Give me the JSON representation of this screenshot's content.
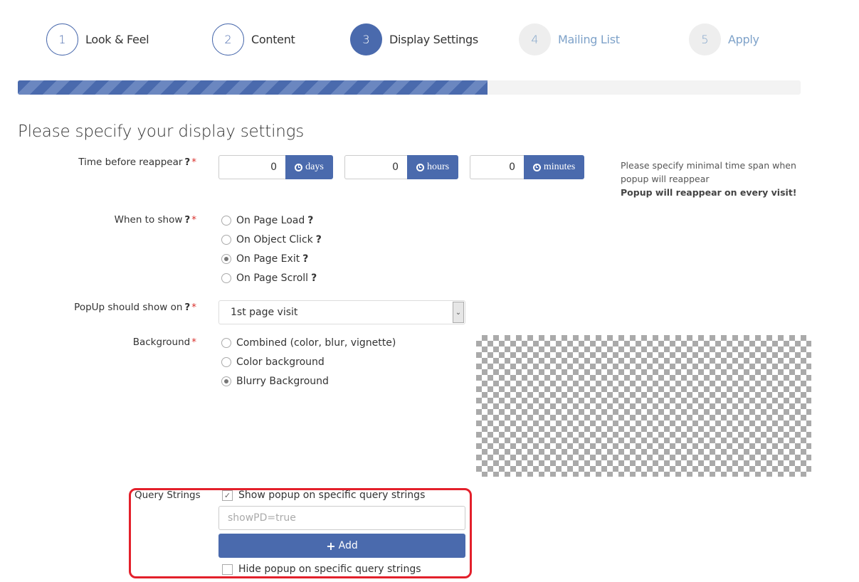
{
  "steps": [
    {
      "number": "1",
      "label": "Look & Feel",
      "state": "done"
    },
    {
      "number": "2",
      "label": "Content",
      "state": "done"
    },
    {
      "number": "3",
      "label": "Display Settings",
      "state": "active"
    },
    {
      "number": "4",
      "label": "Mailing List",
      "state": "todo"
    },
    {
      "number": "5",
      "label": "Apply",
      "state": "todo"
    }
  ],
  "progress": {
    "percent": 60
  },
  "page_title": "Please specify your display settings",
  "colors": {
    "accent": "#4a6aad",
    "required": "#d9302c",
    "highlight_box": "#e3202b"
  },
  "help_glyph": "?",
  "required_glyph": "*",
  "time_before_reappear": {
    "label": "Time before reappear",
    "fields": [
      {
        "value": "0",
        "unit": "days",
        "icon": "clock-icon"
      },
      {
        "value": "0",
        "unit": "hours",
        "icon": "clock-icon"
      },
      {
        "value": "0",
        "unit": "minutes",
        "icon": "clock-icon"
      }
    ],
    "hint": "Please specify minimal time span when popup will reappear",
    "hint_bold": "Popup will reappear on every visit!"
  },
  "when_to_show": {
    "label": "When to show",
    "options": [
      {
        "label": "On Page Load",
        "selected": false
      },
      {
        "label": "On Object Click",
        "selected": false
      },
      {
        "label": "On Page Exit",
        "selected": true
      },
      {
        "label": "On Page Scroll",
        "selected": false
      }
    ]
  },
  "popup_show_on": {
    "label": "PopUp should show on",
    "selected": "1st page visit"
  },
  "background": {
    "label": "Background",
    "options": [
      {
        "label": "Combined (color, blur, vignette)",
        "selected": false
      },
      {
        "label": "Color background",
        "selected": false
      },
      {
        "label": "Blurry Background",
        "selected": true
      }
    ]
  },
  "query_strings": {
    "label": "Query Strings",
    "show_checkbox": {
      "label": "Show popup on specific query strings",
      "checked": true
    },
    "input_placeholder": "showPD=true",
    "input_value": "",
    "add_button": "Add",
    "hide_checkbox": {
      "label": "Hide popup on specific query strings",
      "checked": false
    }
  }
}
